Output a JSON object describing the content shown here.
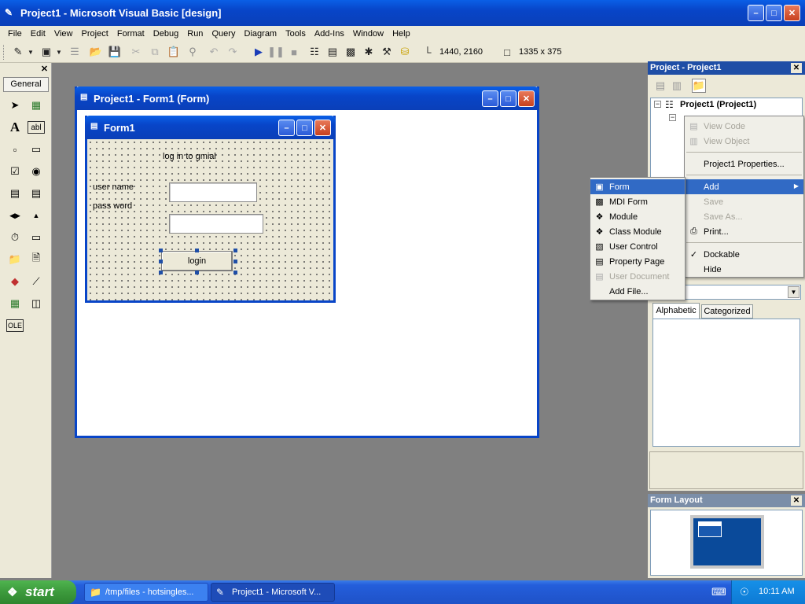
{
  "app": {
    "title": "Project1 - Microsoft Visual Basic [design]"
  },
  "menu": [
    "File",
    "Edit",
    "View",
    "Project",
    "Format",
    "Debug",
    "Run",
    "Query",
    "Diagram",
    "Tools",
    "Add-Ins",
    "Window",
    "Help"
  ],
  "toolbar": {
    "position_readout": "1440, 2160",
    "size_readout": "1335 x 375"
  },
  "toolbox": {
    "tab_label": "General"
  },
  "designer": {
    "window_title": "Project1 - Form1 (Form)",
    "form_title": "Form1",
    "label_heading": "log in to gmial",
    "label_user": "user name",
    "label_pass": "pass word",
    "button_login": "login"
  },
  "project_explorer": {
    "title": "Project - Project1",
    "root_node": "Project1 (Project1)"
  },
  "context_menu": {
    "items": [
      {
        "label": "View Code",
        "disabled": true
      },
      {
        "label": "View Object",
        "disabled": true
      },
      {
        "label": "Project1 Properties...",
        "disabled": false
      },
      {
        "label": "Add",
        "disabled": false
      },
      {
        "label": "Save",
        "disabled": true
      },
      {
        "label": "Save As...",
        "disabled": true
      },
      {
        "label": "Print...",
        "disabled": false
      },
      {
        "label": "Dockable",
        "disabled": false
      },
      {
        "label": "Hide",
        "disabled": false
      }
    ]
  },
  "add_submenu": {
    "items": [
      {
        "label": "Form",
        "disabled": false
      },
      {
        "label": "MDI Form",
        "disabled": false
      },
      {
        "label": "Module",
        "disabled": false
      },
      {
        "label": "Class Module",
        "disabled": false
      },
      {
        "label": "User Control",
        "disabled": false
      },
      {
        "label": "Property Page",
        "disabled": false
      },
      {
        "label": "User Document",
        "disabled": true
      },
      {
        "label": "Add File...",
        "disabled": false
      }
    ]
  },
  "properties": {
    "tab_alphabetic": "Alphabetic",
    "tab_categorized": "Categorized"
  },
  "form_layout": {
    "title": "Form Layout"
  },
  "taskbar": {
    "start_label": "start",
    "task1": "/tmp/files - hotsingles...",
    "task2": "Project1 - Microsoft V...",
    "clock": "10:11 AM"
  },
  "colors": {
    "xp_title_blue": "#0845c8",
    "selection_blue": "#316ac5",
    "taskbar_blue": "#245edb",
    "start_green": "#3c9a3c"
  }
}
